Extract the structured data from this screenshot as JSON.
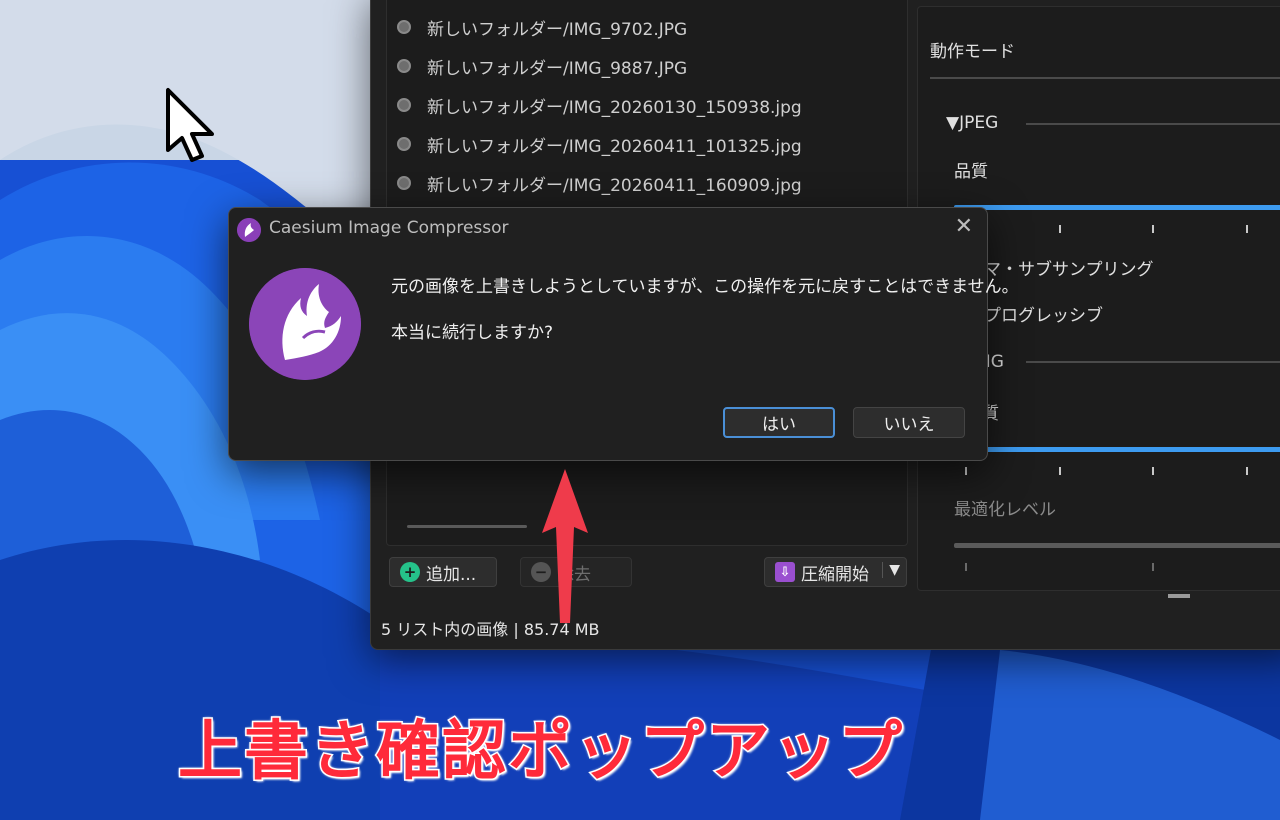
{
  "app": {
    "files": [
      "新しいフォルダー/IMG_9702.JPG",
      "新しいフォルダー/IMG_9887.JPG",
      "新しいフォルダー/IMG_20260130_150938.jpg",
      "新しいフォルダー/IMG_20260411_101325.jpg",
      "新しいフォルダー/IMG_20260411_160909.jpg"
    ],
    "buttons": {
      "add": "追加...",
      "remove": "除去",
      "compress": "圧縮開始"
    },
    "status": "5 リスト内の画像 | 85.74 MB",
    "settings": {
      "mode_label": "動作モード",
      "jpeg_section": "▼JPEG",
      "quality_label": "品質",
      "chroma_label": "マ・サブサンプリング",
      "progressive_label": "プログレッシブ",
      "png_section": "NG",
      "png_quality_label": "質",
      "optimize_label": "最適化レベル"
    },
    "accent_color": "#3d9bf0"
  },
  "dialog": {
    "title": "Caesium Image Compressor",
    "message": "元の画像を上書きしようとしていますが、この操作を元に戻すことはできません。",
    "question": "本当に続行しますか?",
    "yes_label": "はい",
    "no_label": "いいえ",
    "close_icon": "close-icon",
    "logo_color": "#8b45b8"
  },
  "annotation": {
    "caption": "上書き確認ポップアップ",
    "arrow_color": "#ef3b4b"
  }
}
